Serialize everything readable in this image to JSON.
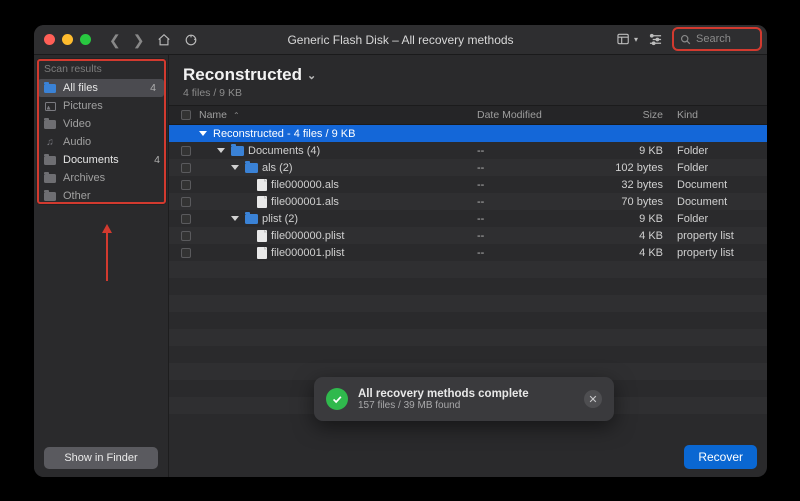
{
  "titlebar": {
    "title": "Generic Flash Disk – All recovery methods",
    "search_placeholder": "Search"
  },
  "sidebar": {
    "heading": "Scan results",
    "items": [
      {
        "label": "All files",
        "count": "4",
        "icon": "folder-blue",
        "selected": true
      },
      {
        "label": "Pictures",
        "count": "",
        "icon": "picture"
      },
      {
        "label": "Video",
        "count": "",
        "icon": "folder-gray"
      },
      {
        "label": "Audio",
        "count": "",
        "icon": "music"
      },
      {
        "label": "Documents",
        "count": "4",
        "icon": "folder-gray",
        "emph": true
      },
      {
        "label": "Archives",
        "count": "",
        "icon": "folder-gray"
      },
      {
        "label": "Other",
        "count": "",
        "icon": "folder-gray"
      }
    ],
    "finder_button": "Show in Finder"
  },
  "header": {
    "title": "Reconstructed",
    "subtitle": "4 files / 9 KB"
  },
  "columns": {
    "name": "Name",
    "date": "Date Modified",
    "size": "Size",
    "kind": "Kind"
  },
  "group_row": "Reconstructed - 4 files / 9 KB",
  "rows": [
    {
      "depth": 1,
      "icon": "folder",
      "disclosure": "open",
      "name": "Documents (4)",
      "date": "--",
      "size": "9 KB",
      "kind": "Folder"
    },
    {
      "depth": 2,
      "icon": "folder",
      "disclosure": "open",
      "name": "als (2)",
      "date": "--",
      "size": "102 bytes",
      "kind": "Folder"
    },
    {
      "depth": 3,
      "icon": "file",
      "disclosure": "",
      "name": "file000000.als",
      "date": "--",
      "size": "32 bytes",
      "kind": "Document"
    },
    {
      "depth": 3,
      "icon": "file",
      "disclosure": "",
      "name": "file000001.als",
      "date": "--",
      "size": "70 bytes",
      "kind": "Document"
    },
    {
      "depth": 2,
      "icon": "folder",
      "disclosure": "open",
      "name": "plist (2)",
      "date": "--",
      "size": "9 KB",
      "kind": "Folder"
    },
    {
      "depth": 3,
      "icon": "file",
      "disclosure": "",
      "name": "file000000.plist",
      "date": "--",
      "size": "4 KB",
      "kind": "property list"
    },
    {
      "depth": 3,
      "icon": "file",
      "disclosure": "",
      "name": "file000001.plist",
      "date": "--",
      "size": "4 KB",
      "kind": "property list"
    }
  ],
  "toast": {
    "message": "All recovery methods complete",
    "sub": "157 files / 39 MB found"
  },
  "buttons": {
    "recover": "Recover"
  }
}
